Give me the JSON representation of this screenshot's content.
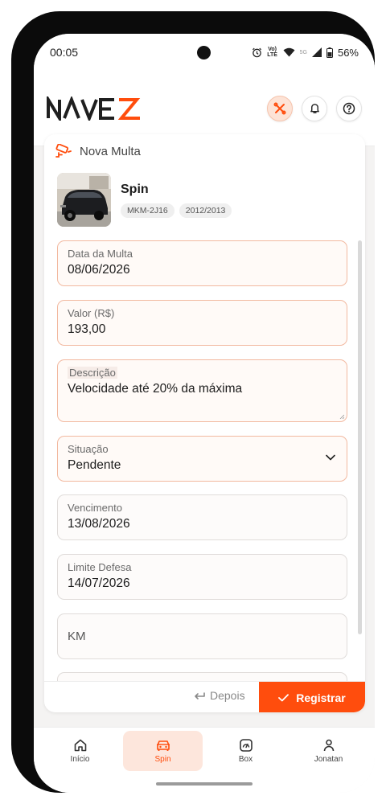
{
  "status_bar": {
    "time": "00:05",
    "volte": "Vo) LTE",
    "net_5g": "5G",
    "battery": "56%"
  },
  "header": {
    "logo_text": "NAVEZ",
    "actions": [
      "tools-icon",
      "bell-icon",
      "help-icon"
    ]
  },
  "card": {
    "title": "Nova Multa",
    "vehicle": {
      "name": "Spin",
      "plate": "MKM-2J16",
      "year": "2012/2013"
    },
    "fields": {
      "data": {
        "label": "Data da Multa",
        "value": "08/06/2026"
      },
      "valor": {
        "label": "Valor (R$)",
        "value": "193,00"
      },
      "descricao": {
        "label": "Descrição",
        "value": "Velocidade até 20% da máxima"
      },
      "situacao": {
        "label": "Situação",
        "value": "Pendente"
      },
      "vencimento": {
        "label": "Vencimento",
        "value": "13/08/2026"
      },
      "limite": {
        "label": "Limite Defesa",
        "value": "14/07/2026"
      },
      "km": {
        "placeholder": "KM"
      }
    },
    "footer": {
      "later_label": "Depois",
      "register_label": "Registrar"
    }
  },
  "nav": {
    "items": [
      {
        "label": "Início",
        "icon": "home-icon"
      },
      {
        "label": "Spin",
        "icon": "car-icon"
      },
      {
        "label": "Box",
        "icon": "gauge-icon"
      },
      {
        "label": "Jonatan",
        "icon": "user-icon"
      }
    ],
    "active_index": 1
  },
  "colors": {
    "accent": "#ff4d0d",
    "field_border": "#f2b9a0",
    "logo_dark": "#1f1f1f"
  }
}
